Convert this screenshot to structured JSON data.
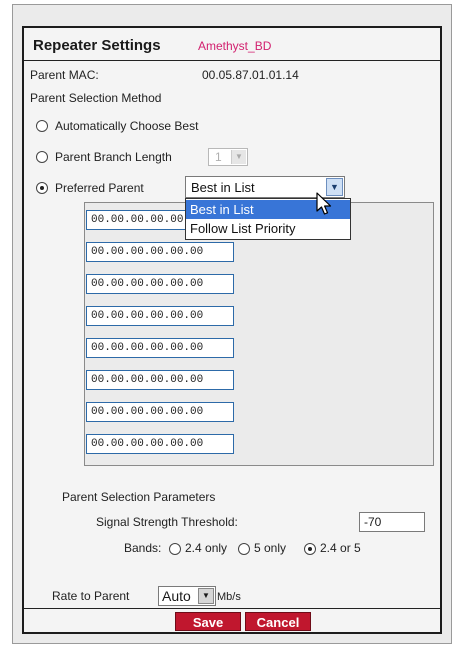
{
  "header": {
    "title": "Repeater Settings",
    "device": "Amethyst_BD"
  },
  "parent_mac": {
    "label": "Parent MAC:",
    "value": "00.05.87.01.01.14"
  },
  "selection_method": {
    "label": "Parent Selection Method",
    "options": {
      "auto": "Automatically Choose Best",
      "branch": "Parent Branch Length",
      "preferred": "Preferred Parent"
    },
    "selected": "preferred",
    "branch_length_value": "1"
  },
  "preferred_select": {
    "value": "Best in List",
    "options": [
      "Best in List",
      "Follow List Priority"
    ]
  },
  "mac_list": [
    "00.00.00.00.00.00",
    "00.00.00.00.00.00",
    "00.00.00.00.00.00",
    "00.00.00.00.00.00",
    "00.00.00.00.00.00",
    "00.00.00.00.00.00",
    "00.00.00.00.00.00",
    "00.00.00.00.00.00"
  ],
  "params": {
    "heading": "Parent Selection Parameters",
    "threshold_label": "Signal Strength Threshold:",
    "threshold_value": "-70",
    "bands_label": "Bands:",
    "bands": {
      "b24": "2.4 only",
      "b5": "5 only",
      "both": "2.4 or 5"
    },
    "bands_selected": "both"
  },
  "rate": {
    "label": "Rate to Parent",
    "value": "Auto",
    "unit": "Mb/s"
  },
  "buttons": {
    "save": "Save",
    "cancel": "Cancel"
  },
  "colors": {
    "device_name": "#d2216f",
    "button": "#c0172e",
    "highlight": "#3875d7"
  }
}
